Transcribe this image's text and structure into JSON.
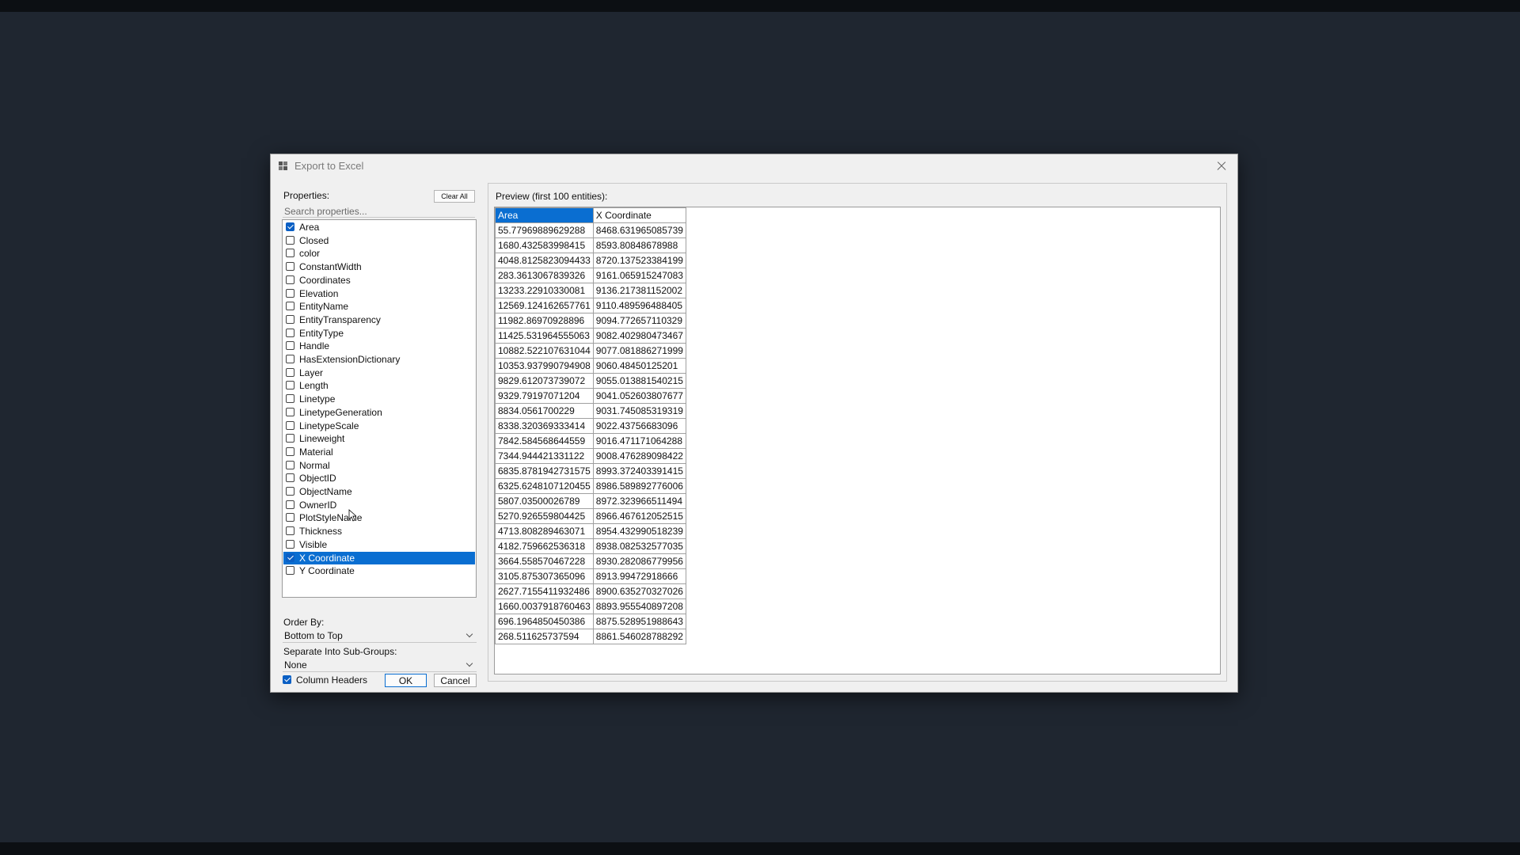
{
  "dialog": {
    "title": "Export to Excel"
  },
  "properties": {
    "label": "Properties:",
    "clear_all_label": "Clear All",
    "search_placeholder": "Search properties...",
    "items": [
      {
        "label": "Area",
        "checked": true,
        "selected": false
      },
      {
        "label": "Closed",
        "checked": false,
        "selected": false
      },
      {
        "label": "color",
        "checked": false,
        "selected": false
      },
      {
        "label": "ConstantWidth",
        "checked": false,
        "selected": false
      },
      {
        "label": "Coordinates",
        "checked": false,
        "selected": false
      },
      {
        "label": "Elevation",
        "checked": false,
        "selected": false
      },
      {
        "label": "EntityName",
        "checked": false,
        "selected": false
      },
      {
        "label": "EntityTransparency",
        "checked": false,
        "selected": false
      },
      {
        "label": "EntityType",
        "checked": false,
        "selected": false
      },
      {
        "label": "Handle",
        "checked": false,
        "selected": false
      },
      {
        "label": "HasExtensionDictionary",
        "checked": false,
        "selected": false
      },
      {
        "label": "Layer",
        "checked": false,
        "selected": false
      },
      {
        "label": "Length",
        "checked": false,
        "selected": false
      },
      {
        "label": "Linetype",
        "checked": false,
        "selected": false
      },
      {
        "label": "LinetypeGeneration",
        "checked": false,
        "selected": false
      },
      {
        "label": "LinetypeScale",
        "checked": false,
        "selected": false
      },
      {
        "label": "Lineweight",
        "checked": false,
        "selected": false
      },
      {
        "label": "Material",
        "checked": false,
        "selected": false
      },
      {
        "label": "Normal",
        "checked": false,
        "selected": false
      },
      {
        "label": "ObjectID",
        "checked": false,
        "selected": false
      },
      {
        "label": "ObjectName",
        "checked": false,
        "selected": false
      },
      {
        "label": "OwnerID",
        "checked": false,
        "selected": false
      },
      {
        "label": "PlotStyleName",
        "checked": false,
        "selected": false
      },
      {
        "label": "Thickness",
        "checked": false,
        "selected": false
      },
      {
        "label": "Visible",
        "checked": false,
        "selected": false
      },
      {
        "label": "X Coordinate",
        "checked": true,
        "selected": true
      },
      {
        "label": "Y Coordinate",
        "checked": false,
        "selected": false
      }
    ]
  },
  "order_by": {
    "label": "Order By:",
    "value": "Bottom to Top"
  },
  "subgroups": {
    "label": "Separate Into Sub-Groups:",
    "value": "None"
  },
  "column_headers": {
    "label": "Column Headers",
    "checked": true
  },
  "buttons": {
    "ok": "OK",
    "cancel": "Cancel"
  },
  "preview": {
    "label": "Preview (first 100 entities):",
    "columns": [
      "Area",
      "X Coordinate"
    ],
    "rows": [
      [
        "55.77969889629288",
        "8468.631965085739"
      ],
      [
        "1680.432583998415",
        "8593.80848678988"
      ],
      [
        "4048.8125823094433",
        "8720.137523384199"
      ],
      [
        "283.3613067839326",
        "9161.065915247083"
      ],
      [
        "13233.22910330081",
        "9136.217381152002"
      ],
      [
        "12569.124162657761",
        "9110.489596488405"
      ],
      [
        "11982.86970928896",
        "9094.772657110329"
      ],
      [
        "11425.531964555063",
        "9082.402980473467"
      ],
      [
        "10882.522107631044",
        "9077.081886271999"
      ],
      [
        "10353.937990794908",
        "9060.48450125201"
      ],
      [
        "9829.612073739072",
        "9055.013881540215"
      ],
      [
        "9329.79197071204",
        "9041.052603807677"
      ],
      [
        "8834.0561700229",
        "9031.745085319319"
      ],
      [
        "8338.320369333414",
        "9022.43756683096"
      ],
      [
        "7842.584568644559",
        "9016.471171064288"
      ],
      [
        "7344.944421331122",
        "9008.476289098422"
      ],
      [
        "6835.8781942731575",
        "8993.372403391415"
      ],
      [
        "6325.6248107120455",
        "8986.589892776006"
      ],
      [
        "5807.03500026789",
        "8972.323966511494"
      ],
      [
        "5270.926559804425",
        "8966.467612052515"
      ],
      [
        "4713.808289463071",
        "8954.432990518239"
      ],
      [
        "4182.759662536318",
        "8938.082532577035"
      ],
      [
        "3664.558570467228",
        "8930.282086779956"
      ],
      [
        "3105.875307365096",
        "8913.99472918666"
      ],
      [
        "2627.7155411932486",
        "8900.635270327026"
      ],
      [
        "1660.0037918760463",
        "8893.955540897208"
      ],
      [
        "696.1964850450386",
        "8875.528951988643"
      ],
      [
        "268.511625737594",
        "8861.546028788292"
      ]
    ]
  }
}
